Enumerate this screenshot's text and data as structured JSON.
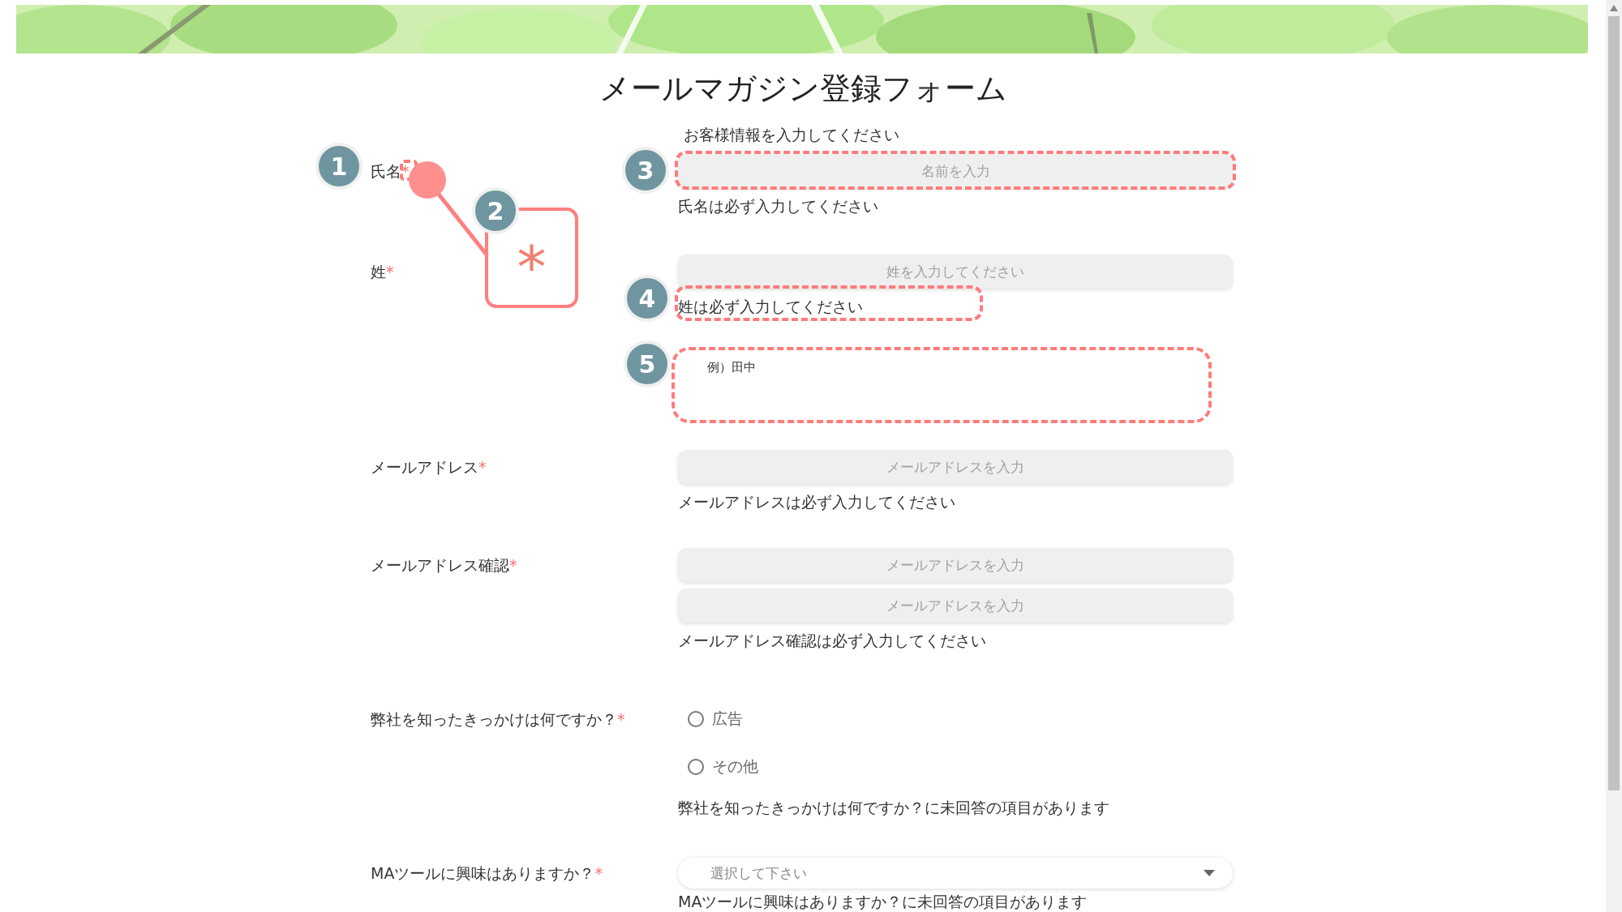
{
  "title": "メールマガジン登録フォーム",
  "intro": "お客様情報を入力してください",
  "fields": [
    {
      "kind": "text",
      "label": "氏名",
      "required_mark": "*",
      "inputs": [
        {
          "placeholder": "名前を入力"
        }
      ],
      "error": "氏名は必ず入力してください"
    },
    {
      "kind": "text",
      "label": "姓",
      "required_mark": "*",
      "inputs": [
        {
          "placeholder": "姓を入力してください"
        }
      ],
      "error": "姓は必ず入力してください",
      "hint": "例）田中"
    },
    {
      "kind": "text",
      "label": "メールアドレス",
      "required_mark": "*",
      "inputs": [
        {
          "placeholder": "メールアドレスを入力"
        }
      ],
      "error": "メールアドレスは必ず入力してください"
    },
    {
      "kind": "text",
      "label": "メールアドレス確認",
      "required_mark": "*",
      "inputs": [
        {
          "placeholder": "メールアドレスを入力"
        },
        {
          "placeholder": "メールアドレスを入力"
        }
      ],
      "error": "メールアドレス確認は必ず入力してください"
    },
    {
      "kind": "radio",
      "label": "弊社を知ったきっかけは何ですか？",
      "required_mark": "*",
      "options": [
        {
          "label": "広告",
          "selected": false
        },
        {
          "label": "その他",
          "selected": false
        }
      ],
      "error": "弊社を知ったきっかけは何ですか？に未回答の項目があります"
    },
    {
      "kind": "select",
      "label": "MAツールに興味はありますか？",
      "required_mark": "*",
      "placeholder": "選択して下さい",
      "error": "MAツールに興味はありますか？に未回答の項目があります"
    }
  ],
  "annotations": {
    "markers": [
      {
        "number": "1"
      },
      {
        "number": "2"
      },
      {
        "number": "3"
      },
      {
        "number": "4"
      },
      {
        "number": "5"
      }
    ],
    "callout": "*"
  }
}
